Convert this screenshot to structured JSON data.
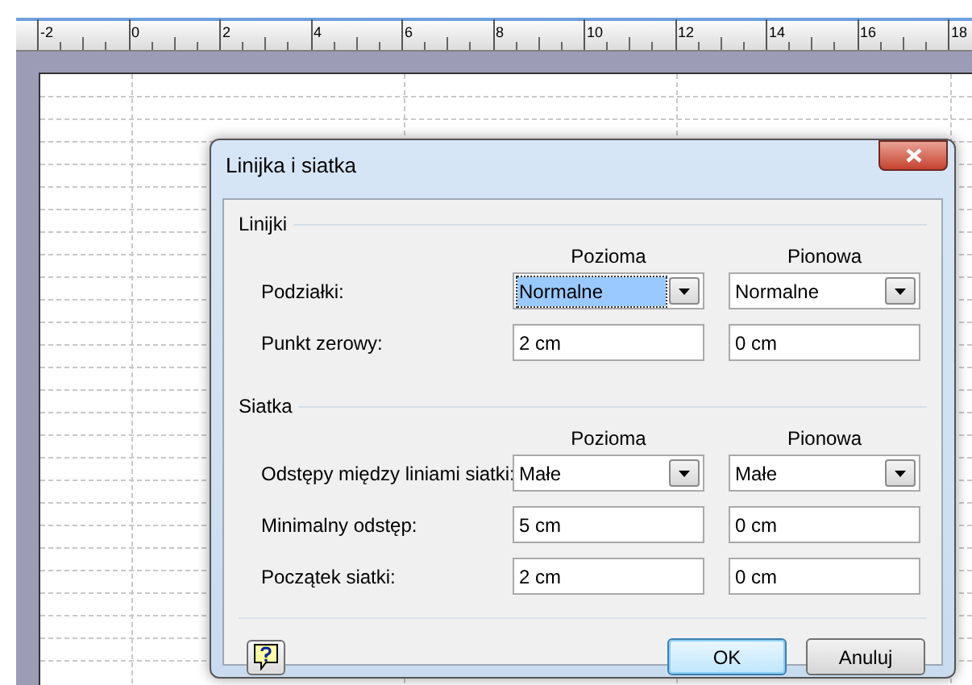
{
  "ruler": {
    "labels": [
      "-2",
      "0",
      "2",
      "4",
      "6",
      "8",
      "10",
      "12",
      "14",
      "16",
      "18"
    ]
  },
  "dialog": {
    "title": "Linijka i siatka",
    "sections": [
      {
        "title": "Linijki",
        "columns": [
          "Pozioma",
          "Pionowa"
        ],
        "rows": [
          {
            "label": "Podziałki:",
            "fields": [
              {
                "kind": "dropdown",
                "value": "Normalne",
                "focused": true
              },
              {
                "kind": "dropdown",
                "value": "Normalne",
                "focused": false
              }
            ]
          },
          {
            "label": "Punkt zerowy:",
            "fields": [
              {
                "kind": "text",
                "value": "2 cm",
                "focused": false
              },
              {
                "kind": "text",
                "value": "0 cm",
                "focused": false
              }
            ]
          }
        ]
      },
      {
        "title": "Siatka",
        "columns": [
          "Pozioma",
          "Pionowa"
        ],
        "rows": [
          {
            "label": "Odstępy między liniami siatki:",
            "fields": [
              {
                "kind": "dropdown",
                "value": "Małe",
                "focused": false
              },
              {
                "kind": "dropdown",
                "value": "Małe",
                "focused": false
              }
            ]
          },
          {
            "label": "Minimalny odstęp:",
            "fields": [
              {
                "kind": "text",
                "value": "5 cm",
                "focused": false
              },
              {
                "kind": "text",
                "value": "0 cm",
                "focused": false
              }
            ]
          },
          {
            "label": "Początek siatki:",
            "fields": [
              {
                "kind": "text",
                "value": "2 cm",
                "focused": false
              },
              {
                "kind": "text",
                "value": "0 cm",
                "focused": false
              }
            ]
          }
        ]
      }
    ],
    "buttons": [
      {
        "label": "OK",
        "default": true
      },
      {
        "label": "Anuluj",
        "default": false
      }
    ]
  }
}
